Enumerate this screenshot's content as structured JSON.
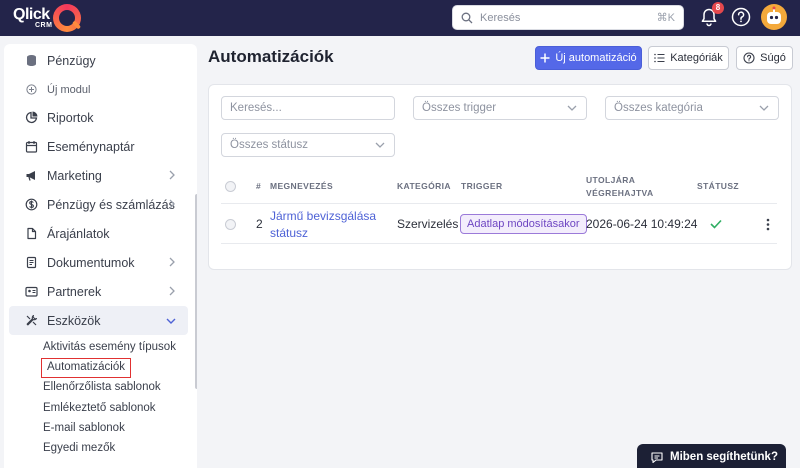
{
  "app": {
    "logo_text": "Qlick",
    "logo_sub": "CRM"
  },
  "topbar": {
    "search_placeholder": "Keresés",
    "search_shortcut": "⌘K",
    "notification_count": "8"
  },
  "sidebar": {
    "items": [
      {
        "label": "Pénzügy",
        "icon": "database-icon"
      },
      {
        "label": "Új modul",
        "icon": "plus-circle-icon"
      },
      {
        "label": "Riportok",
        "icon": "pie-chart-icon"
      },
      {
        "label": "Eseménynaptár",
        "icon": "calendar-icon"
      },
      {
        "label": "Marketing",
        "icon": "megaphone-icon"
      },
      {
        "label": "Pénzügy és számlázás",
        "icon": "money-icon"
      },
      {
        "label": "Árajánlatok",
        "icon": "file-icon"
      },
      {
        "label": "Dokumentumok",
        "icon": "document-icon"
      },
      {
        "label": "Partnerek",
        "icon": "id-card-icon"
      },
      {
        "label": "Eszközök",
        "icon": "tools-icon"
      }
    ],
    "subitems": [
      {
        "label": "Aktivitás esemény típusok"
      },
      {
        "label": "Automatizációk"
      },
      {
        "label": "Ellenőrzőlista sablonok"
      },
      {
        "label": "Emlékeztető sablonok"
      },
      {
        "label": "E-mail sablonok"
      },
      {
        "label": "Egyedi mezők"
      }
    ]
  },
  "main": {
    "title": "Automatizációk",
    "new_button": "Új automatizáció",
    "categories_button": "Kategóriák",
    "help_button": "Súgó",
    "filters": {
      "search_placeholder": "Keresés...",
      "trigger": "Összes trigger",
      "category": "Összes kategória",
      "status": "Összes státusz"
    },
    "table": {
      "headers": {
        "num": "#",
        "name": "MEGNEVEZÉS",
        "category": "KATEGÓRIA",
        "trigger": "TRIGGER",
        "last_run_1": "UTOLJÁRA",
        "last_run_2": "VÉGREHAJTVA",
        "status": "STÁTUSZ"
      },
      "rows": [
        {
          "num": "2",
          "name_line1": "Jármű bevizsgálása",
          "name_line2": "státusz",
          "category": "Szervizelés",
          "trigger": "Adatlap módosításakor",
          "last_run": "2026-06-24 10:49:24",
          "status": "active"
        }
      ]
    }
  },
  "chat": {
    "label": "Miben segíthetünk?"
  },
  "colors": {
    "topbar": "#23244a",
    "primary": "#5468e8",
    "highlight_border": "#e03131",
    "trigger_tag": "#6e46c2",
    "status_ok": "#2fae63"
  }
}
